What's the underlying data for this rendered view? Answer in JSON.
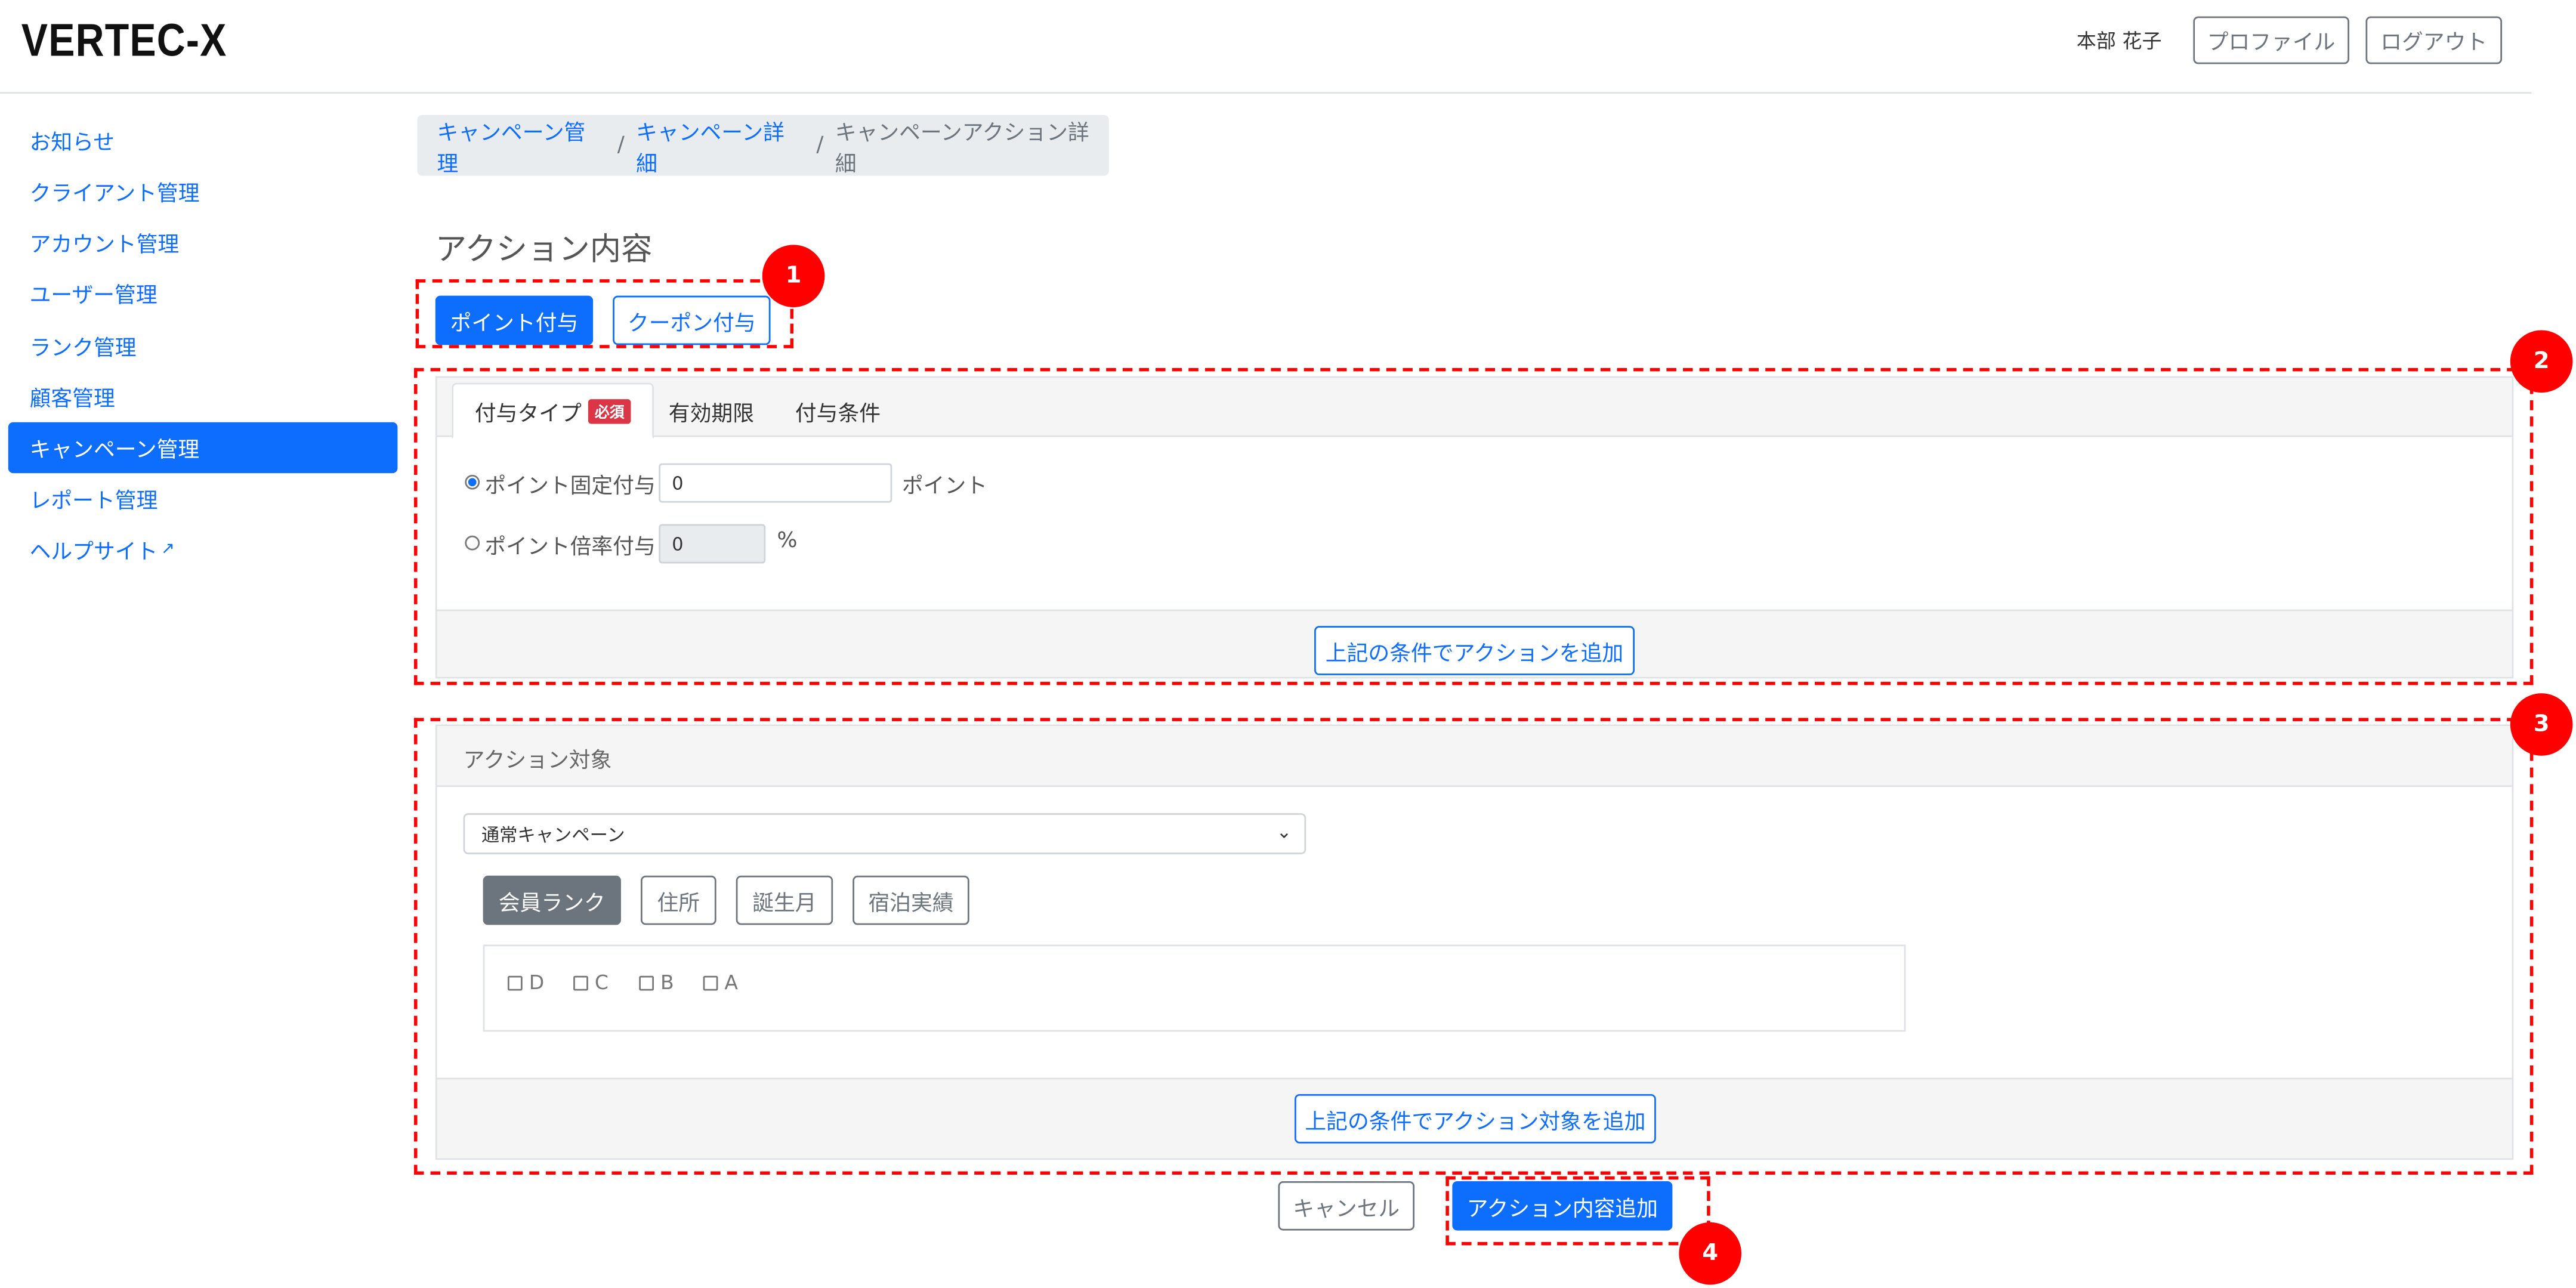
{
  "app": {
    "logo": "VERTEC-X"
  },
  "header": {
    "user_name": "本部 花子",
    "profile_label": "プロファイル",
    "logout_label": "ログアウト"
  },
  "sidebar": {
    "items": [
      {
        "label": "お知らせ"
      },
      {
        "label": "クライアント管理"
      },
      {
        "label": "アカウント管理"
      },
      {
        "label": "ユーザー管理"
      },
      {
        "label": "ランク管理"
      },
      {
        "label": "顧客管理"
      },
      {
        "label": "キャンペーン管理",
        "active": true
      },
      {
        "label": "レポート管理"
      },
      {
        "label": "ヘルプサイト",
        "icon": "external-link-icon"
      }
    ]
  },
  "breadcrumb": {
    "items": [
      "キャンペーン管理",
      "キャンペーン詳細",
      "キャンペーンアクション詳細"
    ],
    "separator": "/"
  },
  "section_title": "アクション内容",
  "action_type_buttons": [
    "ポイント付与",
    "クーポン付与"
  ],
  "grant_card": {
    "tabs": [
      "付与タイプ",
      "有効期限",
      "付与条件"
    ],
    "required_badge": "必須",
    "fixed_label": "ポイント固定付与",
    "fixed_value": "0",
    "fixed_unit": "ポイント",
    "rate_label": "ポイント倍率付与",
    "rate_value": "0",
    "rate_unit": "%",
    "add_button": "上記の条件でアクションを追加"
  },
  "target_card": {
    "title": "アクション対象",
    "select_value": "通常キャンペーン",
    "filter_tabs": [
      "会員ランク",
      "住所",
      "誕生月",
      "宿泊実績"
    ],
    "ranks": [
      "D",
      "C",
      "B",
      "A"
    ],
    "add_button": "上記の条件でアクション対象を追加"
  },
  "footer": {
    "cancel_label": "キャンセル",
    "submit_label": "アクション内容追加"
  },
  "callouts": [
    "1",
    "2",
    "3",
    "4"
  ],
  "colors": {
    "primary": "#0d6efd",
    "callout": "#ff0000",
    "secondary": "#6c757d"
  }
}
